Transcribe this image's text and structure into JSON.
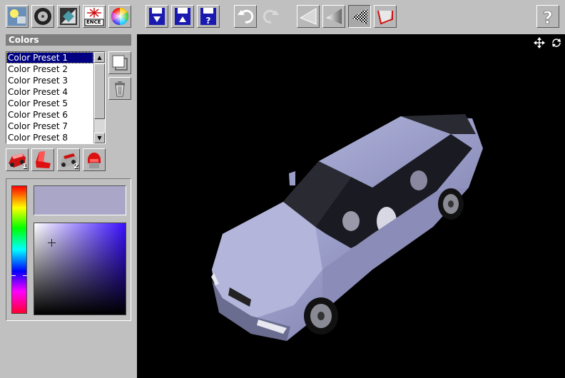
{
  "toolbar": {
    "buttons": [
      {
        "name": "lights-icon"
      },
      {
        "name": "wheels-icon"
      },
      {
        "name": "background-icon"
      },
      {
        "name": "fence-icon",
        "label": "ENCE"
      },
      {
        "name": "color-wheel-icon"
      },
      {
        "name": "save-down-icon"
      },
      {
        "name": "save-up-icon"
      },
      {
        "name": "save-help-icon"
      },
      {
        "name": "undo-icon"
      },
      {
        "name": "redo-icon"
      },
      {
        "name": "flat-shade-icon"
      },
      {
        "name": "smooth-shade-icon"
      },
      {
        "name": "checker-texture-icon"
      },
      {
        "name": "reflection-icon"
      },
      {
        "name": "help-icon"
      }
    ]
  },
  "panel": {
    "title": "Colors",
    "presets": [
      "Color Preset 1",
      "Color Preset 2",
      "Color Preset 3",
      "Color Preset 4",
      "Color Preset 5",
      "Color Preset 6",
      "Color Preset 7",
      "Color Preset 8"
    ],
    "selected_index": 0,
    "part_buttons": [
      {
        "name": "body-color-1-icon",
        "badge": "1"
      },
      {
        "name": "seat-color-icon",
        "badge": ""
      },
      {
        "name": "body-color-2-icon",
        "badge": "2"
      },
      {
        "name": "helmet-color-icon",
        "badge": ""
      }
    ]
  },
  "colors": {
    "current_swatch": "#a9a6c8",
    "hue_base": "#3a10ff",
    "accent_blue": "#000080",
    "car_body": "#9a9dc8"
  }
}
